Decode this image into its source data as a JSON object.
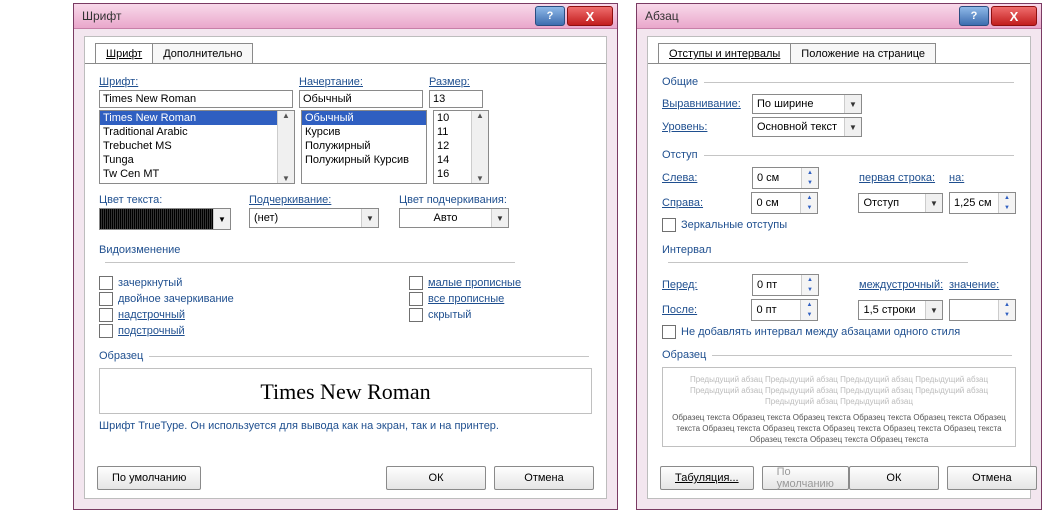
{
  "font": {
    "title": "Шрифт",
    "tabs": [
      "Шрифт",
      "Дополнительно"
    ],
    "labels": {
      "font": "Шрифт:",
      "style": "Начертание:",
      "size": "Размер:",
      "color": "Цвет текста:",
      "under": "Подчеркивание:",
      "ucolor": "Цвет подчеркивания:"
    },
    "font_value": "Times New Roman",
    "font_list": [
      "Times New Roman",
      "Traditional Arabic",
      "Trebuchet MS",
      "Tunga",
      "Tw Cen MT"
    ],
    "style_value": "Обычный",
    "style_list": [
      "Обычный",
      "Курсив",
      "Полужирный",
      "Полужирный Курсив"
    ],
    "size_value": "13",
    "size_list": [
      "10",
      "11",
      "12",
      "14",
      "16"
    ],
    "under_value": "(нет)",
    "ucolor_value": "Авто",
    "mod_title": "Видоизменение",
    "mods_left": [
      "зачеркнутый",
      "двойное зачеркивание",
      "надстрочный",
      "подстрочный"
    ],
    "mods_right": [
      "малые прописные",
      "все прописные",
      "скрытый"
    ],
    "sample_title": "Образец",
    "sample_text": "Times New Roman",
    "desc": "Шрифт TrueType. Он используется для вывода как на экран, так и на принтер.",
    "btn_default": "По умолчанию",
    "btn_ok": "ОК",
    "btn_cancel": "Отмена"
  },
  "para": {
    "title": "Абзац",
    "tabs": [
      "Отступы и интервалы",
      "Положение на странице"
    ],
    "g_general": "Общие",
    "align_l": "Выравнивание:",
    "align_v": "По ширине",
    "level_l": "Уровень:",
    "level_v": "Основной текст",
    "g_indent": "Отступ",
    "left_l": "Слева:",
    "left_v": "0 см",
    "right_l": "Справа:",
    "right_v": "0 см",
    "first_l": "первая строка:",
    "first_v": "Отступ",
    "by_l": "на:",
    "by_v": "1,25 см",
    "mirror": "Зеркальные отступы",
    "g_spacing": "Интервал",
    "before_l": "Перед:",
    "before_v": "0 пт",
    "after_l": "После:",
    "after_v": "0 пт",
    "ls_l": "междустрочный:",
    "ls_v": "1,5 строки",
    "lsb_l": "значение:",
    "lsb_v": "",
    "noadd": "Не добавлять интервал между абзацами одного стиля",
    "sample_title": "Образец",
    "tiny1": "Предыдущий абзац Предыдущий абзац Предыдущий абзац Предыдущий абзац Предыдущий абзац Предыдущий абзац Предыдущий абзац Предыдущий абзац Предыдущий абзац Предыдущий абзац",
    "tiny2": "Образец текста Образец текста Образец текста Образец текста Образец текста Образец текста Образец текста Образец текста Образец текста Образец текста Образец текста Образец текста Образец текста Образец текста",
    "btn_tab": "Табуляция...",
    "btn_default": "По умолчанию",
    "btn_ok": "ОК",
    "btn_cancel": "Отмена"
  }
}
